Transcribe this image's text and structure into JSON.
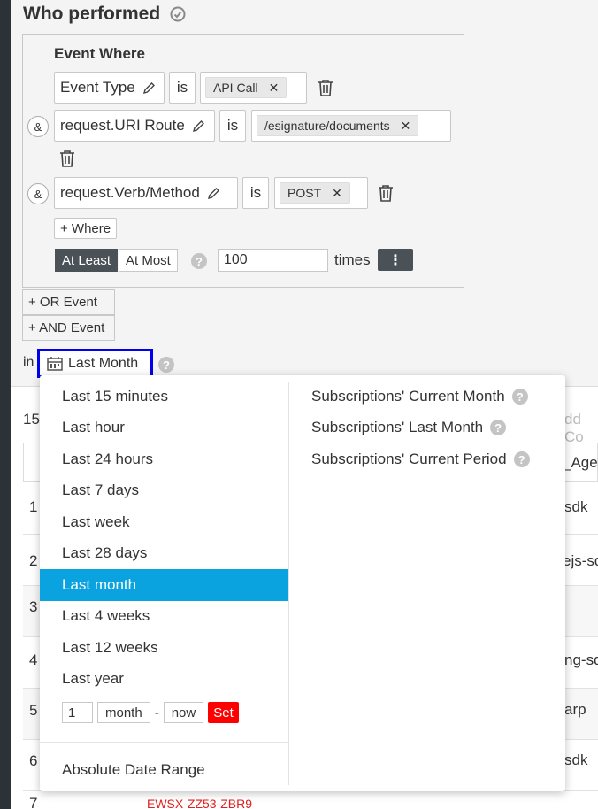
{
  "section": {
    "title": "Who performed"
  },
  "event": {
    "where_label": "Event Where",
    "conditions": [
      {
        "connector": "",
        "field": "Event Type",
        "operator": "is",
        "value": "API Call"
      },
      {
        "connector": "&",
        "field": "request.URI Route",
        "operator": "is",
        "value": "/esignature/documents"
      },
      {
        "connector": "&",
        "field": "request.Verb/Method",
        "operator": "is",
        "value": "POST"
      }
    ],
    "add_where_label": "+ Where",
    "frequency": {
      "options": [
        "At Least",
        "At Most"
      ],
      "selected": "At Least",
      "count": "100",
      "unit_label": "times",
      "more_icon": "kebab-menu-icon"
    }
  },
  "buttons": {
    "or_event": "+ OR Event",
    "and_event": "+ AND Event"
  },
  "time_range": {
    "prefix": "in",
    "selected_label": "Last Month",
    "icon": "calendar-icon"
  },
  "dropdown": {
    "relative_options": [
      "Last 15 minutes",
      "Last hour",
      "Last 24 hours",
      "Last 7 days",
      "Last week",
      "Last 28 days",
      "Last month",
      "Last 4 weeks",
      "Last 12 weeks",
      "Last year"
    ],
    "active_option": "Last month",
    "subscription_options": [
      "Subscriptions' Current Month",
      "Subscriptions' Last Month",
      "Subscriptions' Current Period"
    ],
    "custom": {
      "amount": "1",
      "unit": "month",
      "separator": "-",
      "end": "now",
      "set_label": "Set"
    },
    "absolute_label": "Absolute Date Range"
  },
  "background_table": {
    "count_prefix": "15",
    "add_column_text": "dd Co",
    "header_fragment": "_Agen",
    "rows": [
      {
        "num": "1",
        "right": "sdk"
      },
      {
        "num": "2",
        "right": "ejs-sd"
      },
      {
        "num": "3",
        "right": ""
      },
      {
        "num": "4",
        "right": "ng-sd"
      },
      {
        "num": "5",
        "right": "arp"
      },
      {
        "num": "6",
        "right": "sdk"
      }
    ],
    "partial_row_text": "EWSX-ZZ53-ZBR9"
  },
  "colors": {
    "accent": "#0aa3e0",
    "focus_border": "#0000ee",
    "danger": "#ff0000",
    "dark_button": "#4b5257"
  }
}
